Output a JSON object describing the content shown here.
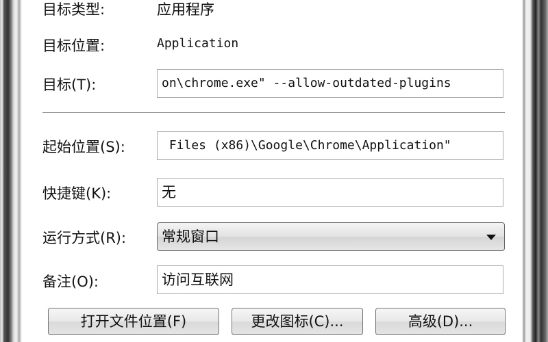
{
  "fields": {
    "target_type": {
      "label": "目标类型:",
      "value": "应用程序"
    },
    "target_location": {
      "label": "目标位置:",
      "value": "Application"
    },
    "target": {
      "label": "目标(T):",
      "value": "on\\chrome.exe\" --allow-outdated-plugins"
    },
    "start_in": {
      "label": "起始位置(S):",
      "value": " Files (x86)\\Google\\Chrome\\Application\""
    },
    "shortcut_key": {
      "label": "快捷键(K):",
      "value": "无"
    },
    "run": {
      "label": "运行方式(R):",
      "value": "常规窗口"
    },
    "comment": {
      "label": "备注(O):",
      "value": "访问互联网"
    }
  },
  "buttons": {
    "open_location": "打开文件位置(F)",
    "change_icon": "更改图标(C)...",
    "advanced": "高级(D)..."
  }
}
